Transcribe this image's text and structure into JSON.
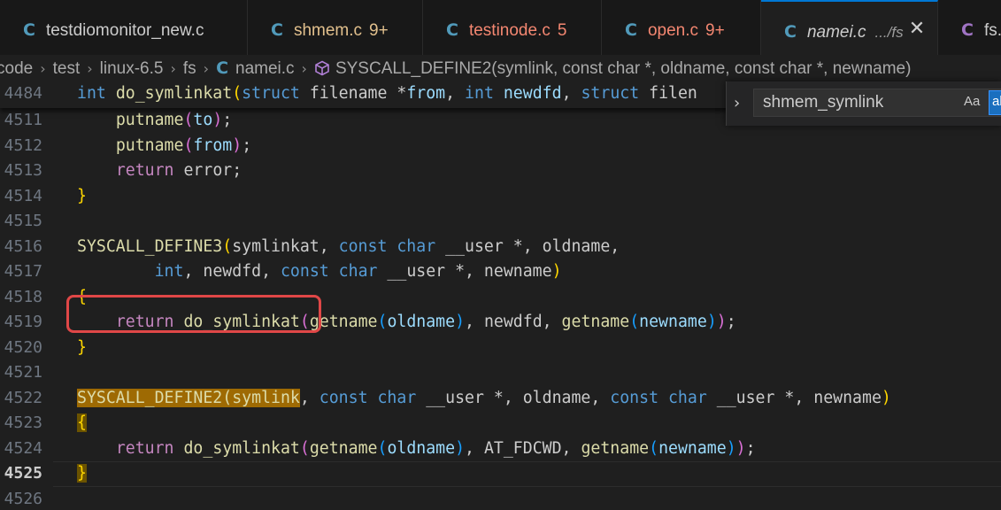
{
  "tabs": [
    {
      "icon": "C",
      "name": "testdiomonitor_new.c",
      "badge": "",
      "desc": "",
      "state": "normal",
      "icon_color": "#519aba"
    },
    {
      "icon": "C",
      "name": "shmem.c",
      "badge": "9+",
      "desc": "",
      "state": "mod",
      "icon_color": "#519aba"
    },
    {
      "icon": "C",
      "name": "testinode.c",
      "badge": "5",
      "desc": "",
      "state": "err",
      "icon_color": "#519aba"
    },
    {
      "icon": "C",
      "name": "open.c",
      "badge": "9+",
      "desc": "",
      "state": "err",
      "icon_color": "#519aba"
    },
    {
      "icon": "C",
      "name": "namei.c",
      "badge": "",
      "desc": ".../fs",
      "state": "active",
      "icon_color": "#519aba",
      "close": "✕"
    },
    {
      "icon": "C",
      "name": "fs.h",
      "badge": "",
      "desc": "",
      "state": "normal",
      "icon_color": "#a074c4"
    }
  ],
  "breadcrumb": {
    "items": [
      "code",
      "test",
      "linux-6.5",
      "fs"
    ],
    "file": "namei.c",
    "file_icon": "C",
    "symbol": "SYSCALL_DEFINE2(symlink, const char  *, oldname, const char  *, newname)"
  },
  "find": {
    "value": "shmem_symlink",
    "match_case": "Aa",
    "whole_word": "ab"
  },
  "editor": {
    "current_line": "4525",
    "lines": [
      {
        "num": "4484",
        "sticky": true,
        "tokens": [
          [
            "kw",
            "int"
          ],
          [
            "t",
            " "
          ],
          [
            "fn",
            "do_symlinkat"
          ],
          [
            "br",
            "("
          ],
          [
            "kw",
            "struct"
          ],
          [
            "t",
            " filename *"
          ],
          [
            "var",
            "from"
          ],
          [
            "t",
            ", "
          ],
          [
            "kw",
            "int"
          ],
          [
            "t",
            " "
          ],
          [
            "var",
            "newdfd"
          ],
          [
            "t",
            ", "
          ],
          [
            "kw",
            "struct"
          ],
          [
            "t",
            " filen"
          ]
        ]
      },
      {
        "num": "4511",
        "tokens": [
          [
            "t",
            "    "
          ],
          [
            "fn",
            "putname"
          ],
          [
            "br2",
            "("
          ],
          [
            "var",
            "to"
          ],
          [
            "br2",
            ")"
          ],
          [
            "t",
            ";"
          ]
        ]
      },
      {
        "num": "4512",
        "tokens": [
          [
            "t",
            "    "
          ],
          [
            "fn",
            "putname"
          ],
          [
            "br2",
            "("
          ],
          [
            "var",
            "from"
          ],
          [
            "br2",
            ")"
          ],
          [
            "t",
            ";"
          ]
        ]
      },
      {
        "num": "4513",
        "tokens": [
          [
            "t",
            "    "
          ],
          [
            "ctl",
            "return"
          ],
          [
            "t",
            " error;"
          ]
        ]
      },
      {
        "num": "4514",
        "tokens": [
          [
            "br",
            "}"
          ]
        ]
      },
      {
        "num": "4515",
        "tokens": []
      },
      {
        "num": "4516",
        "tokens": [
          [
            "fn",
            "SYSCALL_DEFINE3"
          ],
          [
            "br",
            "("
          ],
          [
            "t",
            "symlinkat, "
          ],
          [
            "kw",
            "const"
          ],
          [
            "t",
            " "
          ],
          [
            "kw",
            "char"
          ],
          [
            "t",
            " __user *, oldname,"
          ]
        ]
      },
      {
        "num": "4517",
        "tokens": [
          [
            "t",
            "        "
          ],
          [
            "kw",
            "int"
          ],
          [
            "t",
            ", newdfd, "
          ],
          [
            "kw",
            "const"
          ],
          [
            "t",
            " "
          ],
          [
            "kw",
            "char"
          ],
          [
            "t",
            " __user *, newname"
          ],
          [
            "br",
            ")"
          ]
        ]
      },
      {
        "num": "4518",
        "tokens": [
          [
            "br",
            "{"
          ]
        ]
      },
      {
        "num": "4519",
        "tokens": [
          [
            "t",
            "    "
          ],
          [
            "ctl",
            "return"
          ],
          [
            "t",
            " "
          ],
          [
            "fn",
            "do_symlinkat"
          ],
          [
            "br2",
            "("
          ],
          [
            "fn",
            "getname"
          ],
          [
            "br3",
            "("
          ],
          [
            "var",
            "oldname"
          ],
          [
            "br3",
            ")"
          ],
          [
            "t",
            ", newdfd, "
          ],
          [
            "fn",
            "getname"
          ],
          [
            "br3",
            "("
          ],
          [
            "var",
            "newname"
          ],
          [
            "br3",
            ")"
          ],
          [
            "br2",
            ")"
          ],
          [
            "t",
            ";"
          ]
        ]
      },
      {
        "num": "4520",
        "tokens": [
          [
            "br",
            "}"
          ]
        ]
      },
      {
        "num": "4521",
        "tokens": []
      },
      {
        "num": "4522",
        "tokens": [
          [
            "hl",
            "SYSCALL_DEFINE2(symlink"
          ],
          [
            "t",
            ", "
          ],
          [
            "kw",
            "const"
          ],
          [
            "t",
            " "
          ],
          [
            "kw",
            "char"
          ],
          [
            "t",
            " __user *, oldname, "
          ],
          [
            "kw",
            "const"
          ],
          [
            "t",
            " "
          ],
          [
            "kw",
            "char"
          ],
          [
            "t",
            " __user *, newname"
          ],
          [
            "br",
            ")"
          ]
        ]
      },
      {
        "num": "4523",
        "tokens": [
          [
            "hlb",
            "{"
          ]
        ]
      },
      {
        "num": "4524",
        "tokens": [
          [
            "t",
            "    "
          ],
          [
            "ctl",
            "return"
          ],
          [
            "t",
            " "
          ],
          [
            "fn",
            "do_symlinkat"
          ],
          [
            "br2",
            "("
          ],
          [
            "fn",
            "getname"
          ],
          [
            "br3",
            "("
          ],
          [
            "var",
            "oldname"
          ],
          [
            "br3",
            ")"
          ],
          [
            "t",
            ", AT_FDCWD, "
          ],
          [
            "fn",
            "getname"
          ],
          [
            "br3",
            "("
          ],
          [
            "var",
            "newname"
          ],
          [
            "br3",
            ")"
          ],
          [
            "br2",
            ")"
          ],
          [
            "t",
            ";"
          ]
        ]
      },
      {
        "num": "4525",
        "current": true,
        "tokens": [
          [
            "hlb",
            "}"
          ]
        ]
      },
      {
        "num": "4526",
        "tokens": []
      }
    ]
  },
  "colors": {
    "accent": "#0078d4",
    "highlight_box": "#e04747",
    "find_match": "#9e6a03"
  }
}
